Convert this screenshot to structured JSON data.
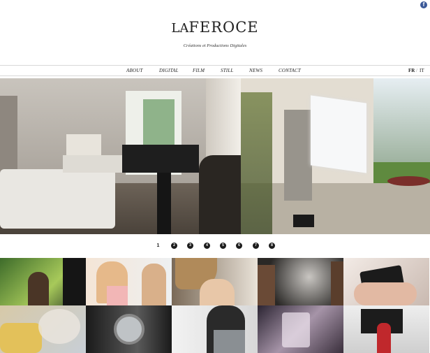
{
  "social": {
    "facebook_glyph": "f",
    "icon": "facebook-icon"
  },
  "brand": {
    "logo_prefix": "La",
    "logo_main": "FEROCE",
    "tagline": "Créations et Productions Digitales"
  },
  "nav": {
    "items": [
      "ABOUT",
      "DIGITAL",
      "FILM",
      "STILL",
      "NEWS",
      "CONTACT"
    ],
    "languages": [
      "FR",
      "IT"
    ],
    "active_language": "FR",
    "language_separator": "/"
  },
  "slider": {
    "pages": [
      "1",
      "2",
      "3",
      "4",
      "5",
      "6",
      "7",
      "8"
    ],
    "current_page": "1"
  },
  "colors": {
    "accent": "#3b5998",
    "dot": "#1c1c1c",
    "divider": "#d8d8d8"
  }
}
